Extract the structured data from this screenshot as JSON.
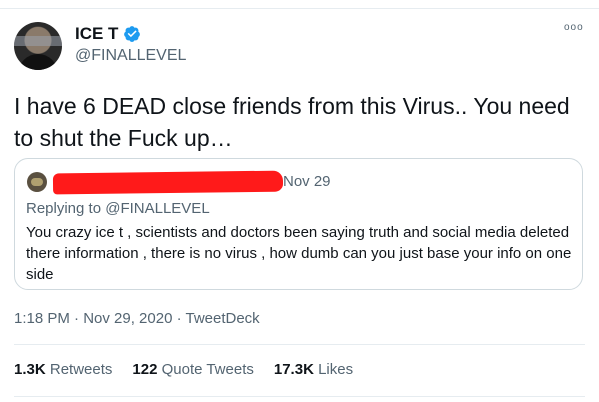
{
  "author": {
    "display_name": "ICE T",
    "handle": "@FINALLEVEL",
    "verified": true,
    "avatar_icon": "profile-photo",
    "verified_icon": "verified-badge-icon"
  },
  "tweet": {
    "text": "I have 6 DEAD close friends from this Virus.. You need to shut the Fuck up…",
    "more_icon": "more-dots-icon",
    "more_glyph": "ooo"
  },
  "quoted": {
    "date": "Nov 29",
    "replying_prefix": "Replying to",
    "replying_handle": "@FINALLEVEL",
    "text": "You crazy ice t , scientists and doctors been saying truth and social media deleted there information , there is no virus , how dumb can you just base your info on one side",
    "redaction_color": "#ff1a1a"
  },
  "meta": {
    "timestamp": "1:18 PM · Nov 29, 2020 · TweetDeck"
  },
  "stats": [
    {
      "count": "1.3K",
      "label": "Retweets"
    },
    {
      "count": "122",
      "label": "Quote Tweets"
    },
    {
      "count": "17.3K",
      "label": "Likes"
    }
  ],
  "colors": {
    "verified_blue": "#1d9bf0",
    "secondary_text": "#536471",
    "border": "#cfd9de"
  }
}
